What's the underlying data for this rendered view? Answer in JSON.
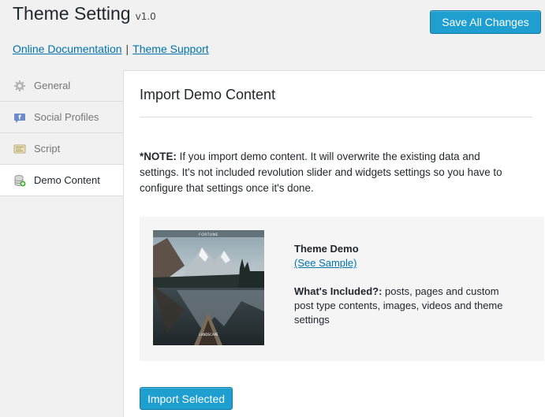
{
  "header": {
    "title": "Theme Setting",
    "version": "v1.0",
    "documentation_link": "Online Documentation",
    "separator": "|",
    "support_link": "Theme Support",
    "save_button": "Save All Changes"
  },
  "sidebar": {
    "items": [
      {
        "label": "General",
        "icon": "gear-icon",
        "active": false
      },
      {
        "label": "Social Profiles",
        "icon": "social-icon",
        "active": false
      },
      {
        "label": "Script",
        "icon": "script-icon",
        "active": false
      },
      {
        "label": "Demo Content",
        "icon": "database-icon",
        "active": true
      }
    ]
  },
  "main": {
    "title": "Import Demo Content",
    "note_label": "*NOTE:",
    "note_text": " If you import demo content. It will overwrite the existing data and settings. It's not included revolution slider and widgets settings so you have to configure that settings once it's done.",
    "demo": {
      "name": "Theme Demo",
      "sample_link": "(See Sample)",
      "included_label": "What's Included?:",
      "included_text": " posts, pages and custom post type contents, images, videos and theme settings",
      "thumbnail_brand": "FORTUNE",
      "thumbnail_caption": "LANDSCAPE"
    },
    "import_button": "Import Selected"
  },
  "colors": {
    "accent": "#1e9fd0",
    "link": "#0073aa",
    "background": "#f1f1f1"
  }
}
